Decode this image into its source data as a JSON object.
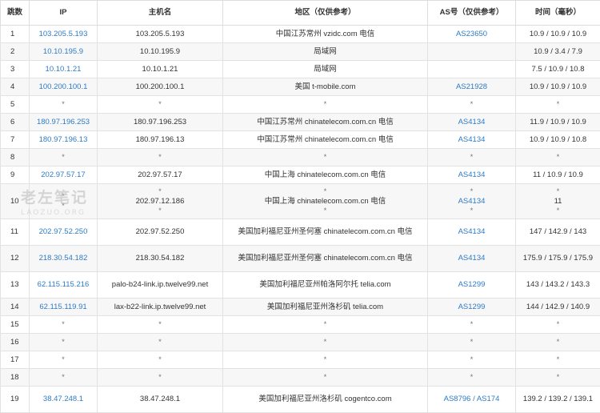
{
  "headers": {
    "hop": "跳数",
    "ip": "IP",
    "hostname": "主机名",
    "location": "地区（仅供参考）",
    "asn": "AS号（仅供参考）",
    "time": "时间（毫秒）"
  },
  "rows": [
    {
      "hop": "1",
      "ip": "103.205.5.193",
      "host": "103.205.5.193",
      "loc": "中国江苏常州 vzidc.com 电信",
      "as": "AS23650",
      "time": "10.9 / 10.9 / 10.9"
    },
    {
      "hop": "2",
      "ip": "10.10.195.9",
      "host": "10.10.195.9",
      "loc": "局域网",
      "as": "",
      "time": "10.9 / 3.4 / 7.9"
    },
    {
      "hop": "3",
      "ip": "10.10.1.21",
      "host": "10.10.1.21",
      "loc": "局域网",
      "as": "",
      "time": "7.5 / 10.9 / 10.8"
    },
    {
      "hop": "4",
      "ip": "100.200.100.1",
      "host": "100.200.100.1",
      "loc": "美国 t-mobile.com",
      "as": "AS21928",
      "time": "10.9 / 10.9 / 10.9"
    },
    {
      "hop": "5",
      "ip": "*",
      "host": "*",
      "loc": "*",
      "as": "*",
      "time": "*"
    },
    {
      "hop": "6",
      "ip": "180.97.196.253",
      "host": "180.97.196.253",
      "loc": "中国江苏常州 chinatelecom.com.cn 电信",
      "as": "AS4134",
      "time": "11.9 / 10.9 / 10.9"
    },
    {
      "hop": "7",
      "ip": "180.97.196.13",
      "host": "180.97.196.13",
      "loc": "中国江苏常州 chinatelecom.com.cn 电信",
      "as": "AS4134",
      "time": "10.9 / 10.9 / 10.8"
    },
    {
      "hop": "8",
      "ip": "*",
      "host": "*",
      "loc": "*",
      "as": "*",
      "time": "*"
    },
    {
      "hop": "9",
      "ip": "202.97.57.17",
      "host": "202.97.57.17",
      "loc": "中国上海 chinatelecom.com.cn 电信",
      "as": "AS4134",
      "time": "11 / 10.9 / 10.9"
    },
    {
      "hop": "10",
      "ip": "*",
      "host": "*",
      "loc": "*",
      "as": "*",
      "time": "*"
    },
    {
      "hop": "",
      "ip": "",
      "host": "202.97.12.186",
      "loc": "中国上海 chinatelecom.com.cn 电信",
      "as": "AS4134",
      "time": "11"
    },
    {
      "hop": "",
      "ip": "*",
      "host": "*",
      "loc": "*",
      "as": "*",
      "time": "*"
    },
    {
      "hop": "11",
      "ip": "202.97.52.250",
      "host": "202.97.52.250",
      "loc": "美国加利福尼亚州圣何塞 chinatelecom.com.cn 电信",
      "as": "AS4134",
      "time": "147 / 142.9 / 143"
    },
    {
      "hop": "12",
      "ip": "218.30.54.182",
      "host": "218.30.54.182",
      "loc": "美国加利福尼亚州圣何塞 chinatelecom.com.cn 电信",
      "as": "AS4134",
      "time": "175.9 / 175.9 / 175.9"
    },
    {
      "hop": "13",
      "ip": "62.115.115.216",
      "host": "palo-b24-link.ip.twelve99.net",
      "loc": "美国加利福尼亚州帕洛阿尔托 telia.com",
      "as": "AS1299",
      "time": "143 / 143.2 / 143.3"
    },
    {
      "hop": "14",
      "ip": "62.115.119.91",
      "host": "lax-b22-link.ip.twelve99.net",
      "loc": "美国加利福尼亚州洛杉矶 telia.com",
      "as": "AS1299",
      "time": "144 / 142.9 / 140.9"
    },
    {
      "hop": "15",
      "ip": "*",
      "host": "*",
      "loc": "*",
      "as": "*",
      "time": "*"
    },
    {
      "hop": "16",
      "ip": "*",
      "host": "*",
      "loc": "*",
      "as": "*",
      "time": "*"
    },
    {
      "hop": "17",
      "ip": "*",
      "host": "*",
      "loc": "*",
      "as": "*",
      "time": "*"
    },
    {
      "hop": "18",
      "ip": "*",
      "host": "*",
      "loc": "*",
      "as": "*",
      "time": "*"
    },
    {
      "hop": "19",
      "ip": "38.47.248.1",
      "host": "38.47.248.1",
      "loc": "美国加利福尼亚州洛杉矶 cogentco.com",
      "as": "AS8796 / AS174",
      "time": "139.2 / 139.2 / 139.1"
    }
  ],
  "watermark": {
    "big": "老左笔记",
    "small": "LAOZUO.ORG"
  }
}
